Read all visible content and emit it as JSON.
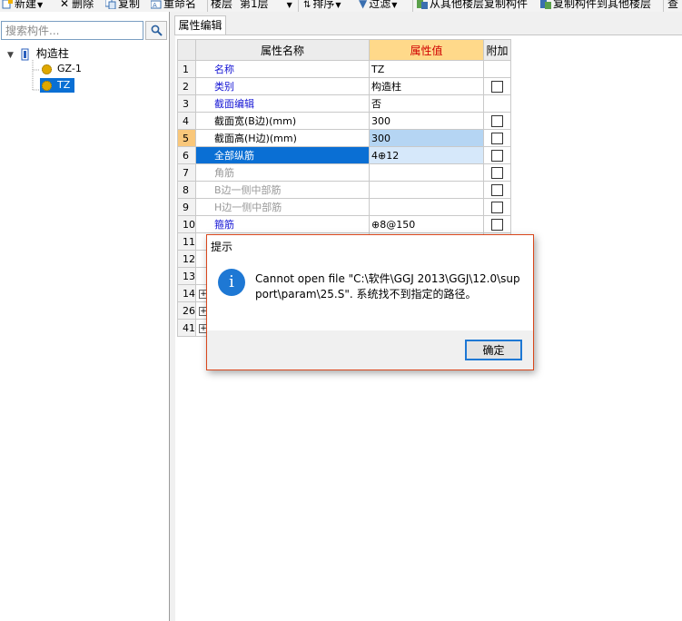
{
  "toolbar": {
    "new_label": "新建",
    "delete_label": "删除",
    "copy_label": "复制",
    "rename_label": "重命名",
    "floor_label": "楼层",
    "floor_value": "第1层",
    "sort_label": "排序",
    "filter_label": "过滤",
    "copy_from_label": "从其他楼层复制构件",
    "copy_to_label": "复制构件到其他楼层",
    "cut_label": "查"
  },
  "search": {
    "placeholder": "搜索构件..."
  },
  "tree": {
    "root_label": "构造柱",
    "items": [
      {
        "label": "GZ-1"
      },
      {
        "label": "TZ"
      }
    ]
  },
  "tabs": {
    "active": "属性编辑"
  },
  "grid": {
    "headers": {
      "name": "属性名称",
      "value": "属性值",
      "extra": "附加"
    },
    "rows": [
      {
        "num": "1",
        "name": "名称",
        "value": "TZ",
        "style": "blue",
        "check": false
      },
      {
        "num": "2",
        "name": "类别",
        "value": "构造柱",
        "style": "blue",
        "check": true
      },
      {
        "num": "3",
        "name": "截面编辑",
        "value": "否",
        "style": "blue",
        "check": false
      },
      {
        "num": "4",
        "name": "截面宽(B边)(mm)",
        "value": "300",
        "style": "black",
        "check": true
      },
      {
        "num": "5",
        "name": "截面高(H边)(mm)",
        "value": "300",
        "style": "black",
        "check": true
      },
      {
        "num": "6",
        "name": "全部纵筋",
        "value": "4⊕12",
        "style": "blue",
        "check": true
      },
      {
        "num": "7",
        "name": "角筋",
        "value": "",
        "style": "gray",
        "check": true
      },
      {
        "num": "8",
        "name": "B边一侧中部筋",
        "value": "",
        "style": "gray",
        "check": true
      },
      {
        "num": "9",
        "name": "H边一侧中部筋",
        "value": "",
        "style": "gray",
        "check": true
      },
      {
        "num": "10",
        "name": "箍筋",
        "value": "⊕8@150",
        "style": "blue",
        "check": true
      },
      {
        "num": "11",
        "name": "",
        "value": "",
        "style": "black",
        "check": false
      },
      {
        "num": "12",
        "name": "",
        "value": "",
        "style": "black",
        "check": false
      },
      {
        "num": "13",
        "name": "",
        "value": "",
        "style": "black",
        "check": false
      },
      {
        "num": "14",
        "name": "",
        "value": "",
        "style": "black",
        "check": false,
        "expand": true
      },
      {
        "num": "26",
        "name": "",
        "value": "",
        "style": "black",
        "check": false,
        "expand": true
      },
      {
        "num": "41",
        "name": "",
        "value": "",
        "style": "black",
        "check": false,
        "expand": true
      }
    ]
  },
  "dialog": {
    "title": "提示",
    "message": "Cannot open file \"C:\\软件\\GGJ 2013\\GGJ\\12.0\\support\\param\\25.S\". 系统找不到指定的路径。",
    "ok_label": "确定"
  },
  "colors": {
    "selection_blue": "#0a6fd4",
    "value_header": "#ffd98a",
    "dialog_border": "#d9471c",
    "info_icon": "#1e78d4"
  }
}
